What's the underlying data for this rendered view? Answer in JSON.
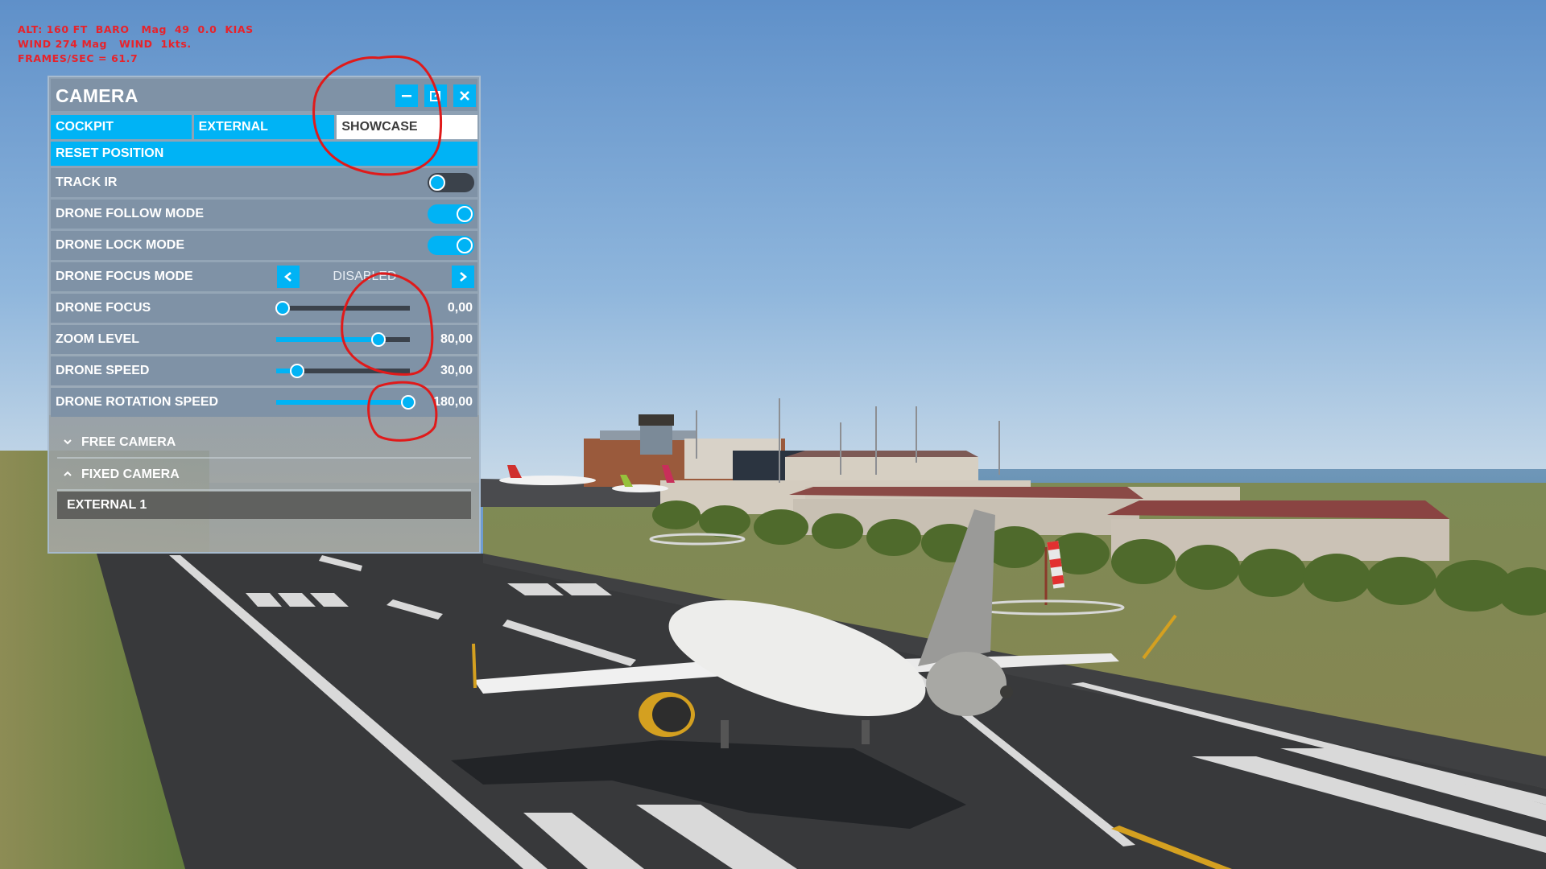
{
  "hud": {
    "line1": "ALT: 160 FT  BARO   Mag  49  0.0  KIAS",
    "line2": "WIND 274 Mag   WIND  1kts.",
    "line3": "FRAMES/SEC = 61.7"
  },
  "panel": {
    "title": "CAMERA",
    "window_buttons": [
      {
        "name": "minimize",
        "icon": "minus-icon"
      },
      {
        "name": "undock",
        "icon": "external-window-icon"
      },
      {
        "name": "close",
        "icon": "close-icon"
      }
    ],
    "tabs": [
      {
        "label": "COCKPIT",
        "active": false
      },
      {
        "label": "EXTERNAL",
        "active": false
      },
      {
        "label": "SHOWCASE",
        "active": true
      }
    ],
    "reset_label": "RESET POSITION",
    "toggles": [
      {
        "label": "TRACK IR",
        "on": false
      },
      {
        "label": "DRONE FOLLOW MODE",
        "on": true
      },
      {
        "label": "DRONE LOCK MODE",
        "on": true
      }
    ],
    "focus_mode": {
      "label": "DRONE FOCUS MODE",
      "value": "DISABLED",
      "prev_icon": "chevron-left-icon",
      "next_icon": "chevron-right-icon"
    },
    "sliders": [
      {
        "label": "DRONE FOCUS",
        "value": "0,00",
        "fraction": 0.04,
        "fill": false
      },
      {
        "label": "ZOOM LEVEL",
        "value": "80,00",
        "fraction": 0.76,
        "fill": true
      },
      {
        "label": "DRONE SPEED",
        "value": "30,00",
        "fraction": 0.15,
        "fill": true
      },
      {
        "label": "DRONE ROTATION SPEED",
        "value": "180,00",
        "fraction": 0.98,
        "fill": true
      }
    ],
    "sections": [
      {
        "label": "FREE CAMERA",
        "expanded": false,
        "icon": "chevron-down-icon"
      },
      {
        "label": "FIXED CAMERA",
        "expanded": true,
        "icon": "chevron-up-icon",
        "items": [
          "EXTERNAL 1"
        ]
      }
    ]
  },
  "colors": {
    "accent": "#00b3f5",
    "panel_row": "#7f92a6",
    "toggle_off": "#3b424b",
    "hud_text": "#e8222a",
    "annotation": "#e01a1a"
  }
}
